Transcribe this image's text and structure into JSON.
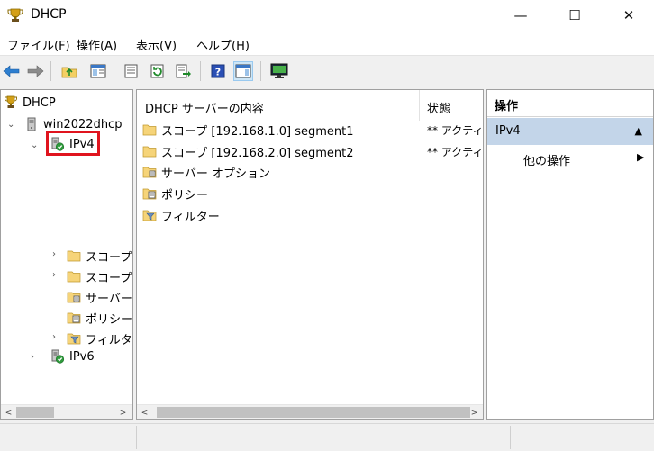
{
  "window": {
    "title": "DHCP",
    "minimize": "—",
    "maximize": "☐",
    "close": "✕",
    "app_icon": "dhcp-trophy-icon"
  },
  "menu": [
    "ファイル(F)",
    "操作(A)",
    "表示(V)",
    "ヘルプ(H)"
  ],
  "toolbar": {
    "icons": [
      "back-icon",
      "forward-icon",
      "up-folder-icon",
      "show-hide-tree-icon",
      "properties-icon",
      "refresh-icon",
      "export-list-icon",
      "help-icon",
      "show-hide-action-pane-icon",
      "monitor-icon"
    ]
  },
  "tree": {
    "root": "DHCP",
    "server": "win2022dhcp",
    "ipv4": "IPv4",
    "children": [
      "スコープ",
      "スコープ",
      "サーバー",
      "ポリシー",
      "フィルター"
    ],
    "ipv6": "IPv6"
  },
  "list": {
    "columns": [
      "DHCP サーバーの内容",
      "状態"
    ],
    "rows": [
      {
        "name": "スコープ [192.168.1.0] segment1",
        "status": "** アクティ"
      },
      {
        "name": "スコープ [192.168.2.0] segment2",
        "status": "** アクティ"
      },
      {
        "name": "サーバー オプション",
        "status": ""
      },
      {
        "name": "ポリシー",
        "status": ""
      },
      {
        "name": "フィルター",
        "status": ""
      }
    ]
  },
  "actions": {
    "header": "操作",
    "section": "IPv4",
    "section_toggle": "▲",
    "item": "他の操作",
    "item_arrow": "▶"
  },
  "scroll": {
    "left": "<",
    "right": ">"
  },
  "colors": {
    "selection_highlight": "#e0141e",
    "action_section_bg": "#c3d5e9",
    "toolbar_selected_bg": "#cde6f7"
  }
}
